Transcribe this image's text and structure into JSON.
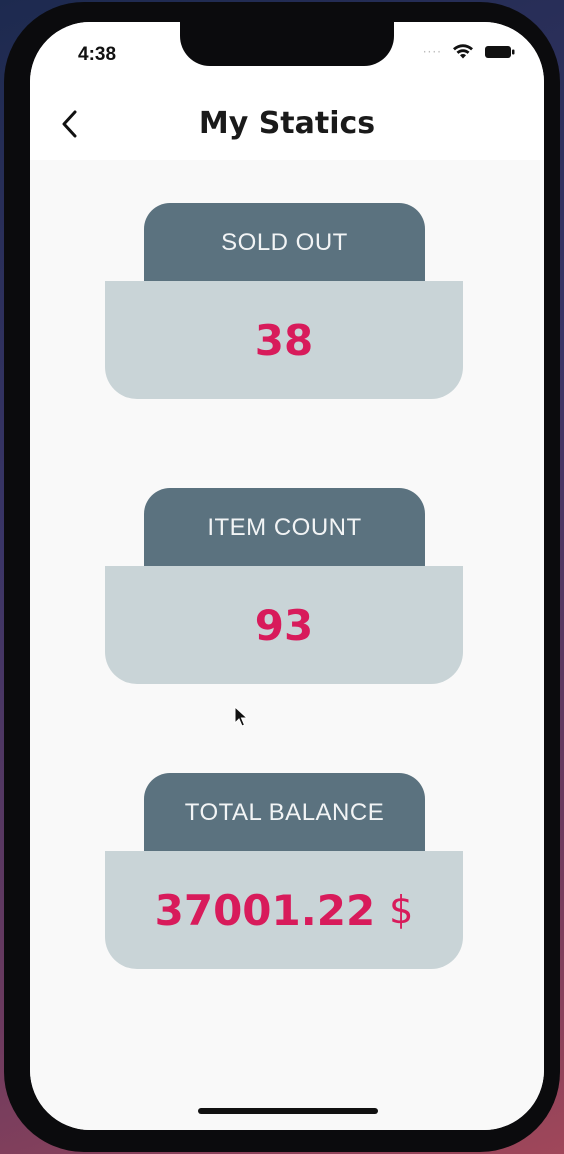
{
  "status_bar": {
    "time": "4:38",
    "icons": [
      "signal-dots",
      "wifi-icon",
      "battery-icon"
    ]
  },
  "nav": {
    "title": "My Statics",
    "back_icon": "chevron-left-icon"
  },
  "stats": [
    {
      "label": "SOLD OUT",
      "value": "38",
      "unit": ""
    },
    {
      "label": "ITEM COUNT",
      "value": "93",
      "unit": ""
    },
    {
      "label": "TOTAL BALANCE",
      "value": "37001.22",
      "unit": "$"
    }
  ],
  "colors": {
    "tab": "#5b727f",
    "card_body": "#c9d4d7",
    "value_text": "#d81b5b",
    "background": "#f9f9f9"
  }
}
